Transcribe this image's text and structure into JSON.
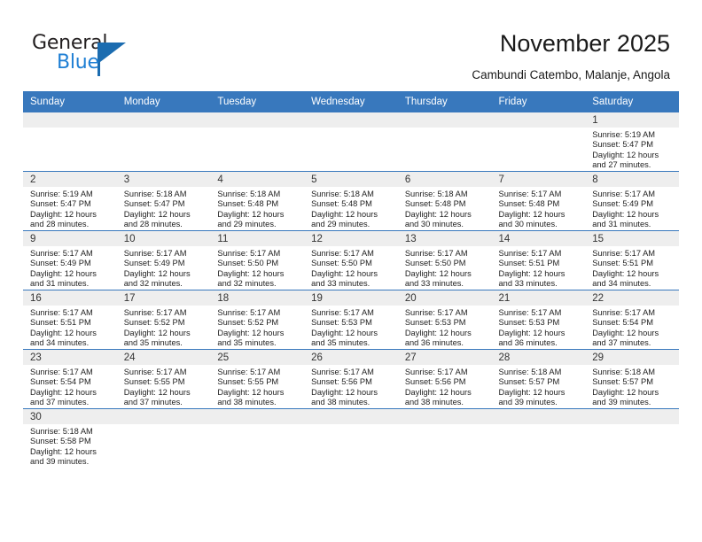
{
  "logo": {
    "word_top": "General",
    "word_bottom": "Blue",
    "brand_color": "#1b6cb0",
    "accent_color": "#1f7fd4"
  },
  "header": {
    "title": "November 2025",
    "subtitle": "Cambundi Catembo, Malanje, Angola"
  },
  "calendar": {
    "header_bg": "#3878bd",
    "weekday_headers": [
      "Sunday",
      "Monday",
      "Tuesday",
      "Wednesday",
      "Thursday",
      "Friday",
      "Saturday"
    ],
    "weeks": [
      [
        {
          "day": "",
          "lines": []
        },
        {
          "day": "",
          "lines": []
        },
        {
          "day": "",
          "lines": []
        },
        {
          "day": "",
          "lines": []
        },
        {
          "day": "",
          "lines": []
        },
        {
          "day": "",
          "lines": []
        },
        {
          "day": "1",
          "lines": [
            "Sunrise: 5:19 AM",
            "Sunset: 5:47 PM",
            "Daylight: 12 hours",
            "and 27 minutes."
          ]
        }
      ],
      [
        {
          "day": "2",
          "lines": [
            "Sunrise: 5:19 AM",
            "Sunset: 5:47 PM",
            "Daylight: 12 hours",
            "and 28 minutes."
          ]
        },
        {
          "day": "3",
          "lines": [
            "Sunrise: 5:18 AM",
            "Sunset: 5:47 PM",
            "Daylight: 12 hours",
            "and 28 minutes."
          ]
        },
        {
          "day": "4",
          "lines": [
            "Sunrise: 5:18 AM",
            "Sunset: 5:48 PM",
            "Daylight: 12 hours",
            "and 29 minutes."
          ]
        },
        {
          "day": "5",
          "lines": [
            "Sunrise: 5:18 AM",
            "Sunset: 5:48 PM",
            "Daylight: 12 hours",
            "and 29 minutes."
          ]
        },
        {
          "day": "6",
          "lines": [
            "Sunrise: 5:18 AM",
            "Sunset: 5:48 PM",
            "Daylight: 12 hours",
            "and 30 minutes."
          ]
        },
        {
          "day": "7",
          "lines": [
            "Sunrise: 5:17 AM",
            "Sunset: 5:48 PM",
            "Daylight: 12 hours",
            "and 30 minutes."
          ]
        },
        {
          "day": "8",
          "lines": [
            "Sunrise: 5:17 AM",
            "Sunset: 5:49 PM",
            "Daylight: 12 hours",
            "and 31 minutes."
          ]
        }
      ],
      [
        {
          "day": "9",
          "lines": [
            "Sunrise: 5:17 AM",
            "Sunset: 5:49 PM",
            "Daylight: 12 hours",
            "and 31 minutes."
          ]
        },
        {
          "day": "10",
          "lines": [
            "Sunrise: 5:17 AM",
            "Sunset: 5:49 PM",
            "Daylight: 12 hours",
            "and 32 minutes."
          ]
        },
        {
          "day": "11",
          "lines": [
            "Sunrise: 5:17 AM",
            "Sunset: 5:50 PM",
            "Daylight: 12 hours",
            "and 32 minutes."
          ]
        },
        {
          "day": "12",
          "lines": [
            "Sunrise: 5:17 AM",
            "Sunset: 5:50 PM",
            "Daylight: 12 hours",
            "and 33 minutes."
          ]
        },
        {
          "day": "13",
          "lines": [
            "Sunrise: 5:17 AM",
            "Sunset: 5:50 PM",
            "Daylight: 12 hours",
            "and 33 minutes."
          ]
        },
        {
          "day": "14",
          "lines": [
            "Sunrise: 5:17 AM",
            "Sunset: 5:51 PM",
            "Daylight: 12 hours",
            "and 33 minutes."
          ]
        },
        {
          "day": "15",
          "lines": [
            "Sunrise: 5:17 AM",
            "Sunset: 5:51 PM",
            "Daylight: 12 hours",
            "and 34 minutes."
          ]
        }
      ],
      [
        {
          "day": "16",
          "lines": [
            "Sunrise: 5:17 AM",
            "Sunset: 5:51 PM",
            "Daylight: 12 hours",
            "and 34 minutes."
          ]
        },
        {
          "day": "17",
          "lines": [
            "Sunrise: 5:17 AM",
            "Sunset: 5:52 PM",
            "Daylight: 12 hours",
            "and 35 minutes."
          ]
        },
        {
          "day": "18",
          "lines": [
            "Sunrise: 5:17 AM",
            "Sunset: 5:52 PM",
            "Daylight: 12 hours",
            "and 35 minutes."
          ]
        },
        {
          "day": "19",
          "lines": [
            "Sunrise: 5:17 AM",
            "Sunset: 5:53 PM",
            "Daylight: 12 hours",
            "and 35 minutes."
          ]
        },
        {
          "day": "20",
          "lines": [
            "Sunrise: 5:17 AM",
            "Sunset: 5:53 PM",
            "Daylight: 12 hours",
            "and 36 minutes."
          ]
        },
        {
          "day": "21",
          "lines": [
            "Sunrise: 5:17 AM",
            "Sunset: 5:53 PM",
            "Daylight: 12 hours",
            "and 36 minutes."
          ]
        },
        {
          "day": "22",
          "lines": [
            "Sunrise: 5:17 AM",
            "Sunset: 5:54 PM",
            "Daylight: 12 hours",
            "and 37 minutes."
          ]
        }
      ],
      [
        {
          "day": "23",
          "lines": [
            "Sunrise: 5:17 AM",
            "Sunset: 5:54 PM",
            "Daylight: 12 hours",
            "and 37 minutes."
          ]
        },
        {
          "day": "24",
          "lines": [
            "Sunrise: 5:17 AM",
            "Sunset: 5:55 PM",
            "Daylight: 12 hours",
            "and 37 minutes."
          ]
        },
        {
          "day": "25",
          "lines": [
            "Sunrise: 5:17 AM",
            "Sunset: 5:55 PM",
            "Daylight: 12 hours",
            "and 38 minutes."
          ]
        },
        {
          "day": "26",
          "lines": [
            "Sunrise: 5:17 AM",
            "Sunset: 5:56 PM",
            "Daylight: 12 hours",
            "and 38 minutes."
          ]
        },
        {
          "day": "27",
          "lines": [
            "Sunrise: 5:17 AM",
            "Sunset: 5:56 PM",
            "Daylight: 12 hours",
            "and 38 minutes."
          ]
        },
        {
          "day": "28",
          "lines": [
            "Sunrise: 5:18 AM",
            "Sunset: 5:57 PM",
            "Daylight: 12 hours",
            "and 39 minutes."
          ]
        },
        {
          "day": "29",
          "lines": [
            "Sunrise: 5:18 AM",
            "Sunset: 5:57 PM",
            "Daylight: 12 hours",
            "and 39 minutes."
          ]
        }
      ],
      [
        {
          "day": "30",
          "lines": [
            "Sunrise: 5:18 AM",
            "Sunset: 5:58 PM",
            "Daylight: 12 hours",
            "and 39 minutes."
          ]
        },
        {
          "day": "",
          "lines": []
        },
        {
          "day": "",
          "lines": []
        },
        {
          "day": "",
          "lines": []
        },
        {
          "day": "",
          "lines": []
        },
        {
          "day": "",
          "lines": []
        },
        {
          "day": "",
          "lines": []
        }
      ]
    ]
  }
}
